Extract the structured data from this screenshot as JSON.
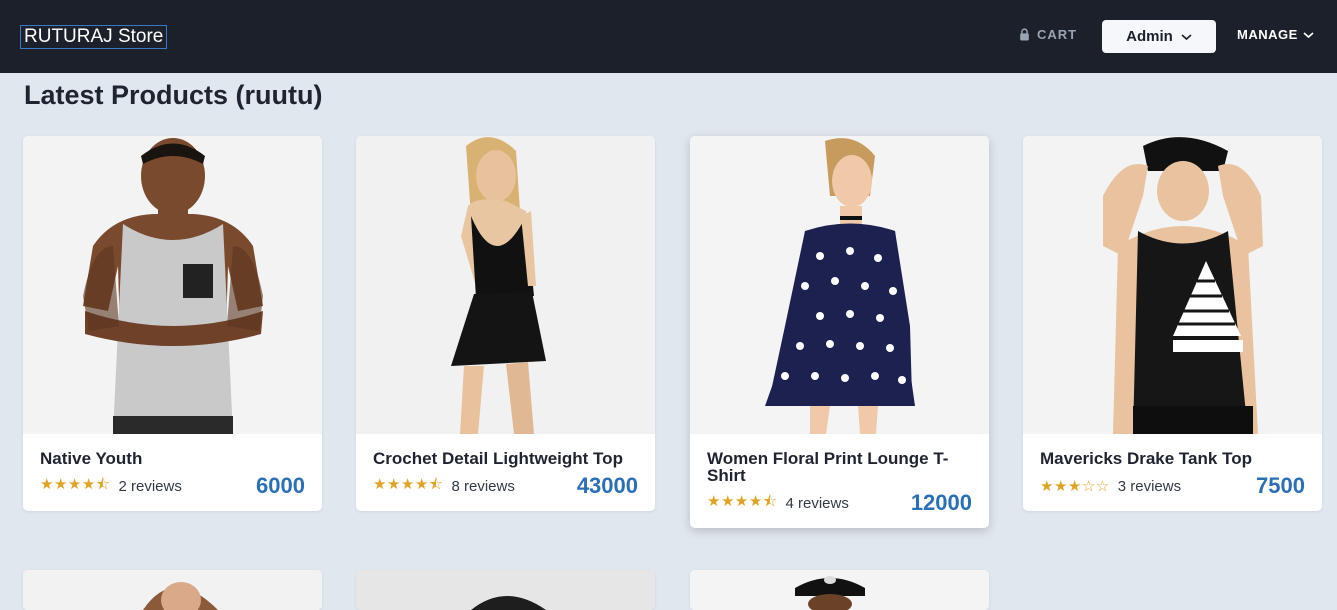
{
  "nav": {
    "brand": "RUTURAJ Store",
    "cart_label": "CART",
    "admin_label": "Admin",
    "manage_label": "MANAGE"
  },
  "page": {
    "title": "Latest Products (ruutu)"
  },
  "products": [
    {
      "name": "Native Youth",
      "stars": "★★★★⯪",
      "reviews": "2 reviews",
      "price": "6000",
      "rating": 4.5,
      "image": "man-grey-tank-top-icon"
    },
    {
      "name": "Crochet Detail Lightweight Top",
      "stars": "★★★★⯪",
      "reviews": "8 reviews",
      "price": "43000",
      "rating": 4.5,
      "image": "woman-black-dress-icon"
    },
    {
      "name": "Women Floral Print Lounge T-Shirt",
      "stars": "★★★★⯪",
      "reviews": "4 reviews",
      "price": "12000",
      "rating": 4.5,
      "image": "woman-polka-dot-dress-icon"
    },
    {
      "name": "Mavericks Drake Tank Top",
      "stars": "★★★☆☆",
      "reviews": "3 reviews",
      "price": "7500",
      "rating": 3,
      "image": "man-black-tank-top-icon"
    }
  ],
  "colors": {
    "navbar": "#1b202b",
    "background": "#e1e7ef",
    "price": "#2b6fb6",
    "star": "#e0a326"
  }
}
